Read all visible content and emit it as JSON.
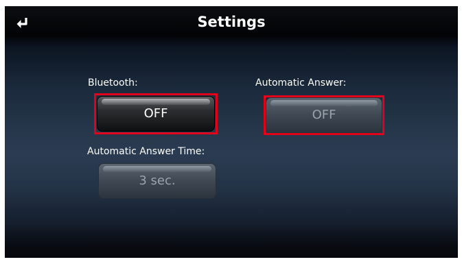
{
  "header": {
    "title": "Settings",
    "back_icon": "return-arrow-icon"
  },
  "settings": {
    "bluetooth": {
      "label": "Bluetooth:",
      "value": "OFF",
      "state": "enabled"
    },
    "automatic_answer": {
      "label": "Automatic Answer:",
      "value": "OFF",
      "state": "disabled"
    },
    "automatic_answer_time": {
      "label": "Automatic Answer Time:",
      "value": "3 sec.",
      "state": "disabled"
    }
  },
  "colors": {
    "highlight": "#e3001b",
    "title_text": "#ffffff",
    "disabled_text": "#9ba3ab"
  }
}
